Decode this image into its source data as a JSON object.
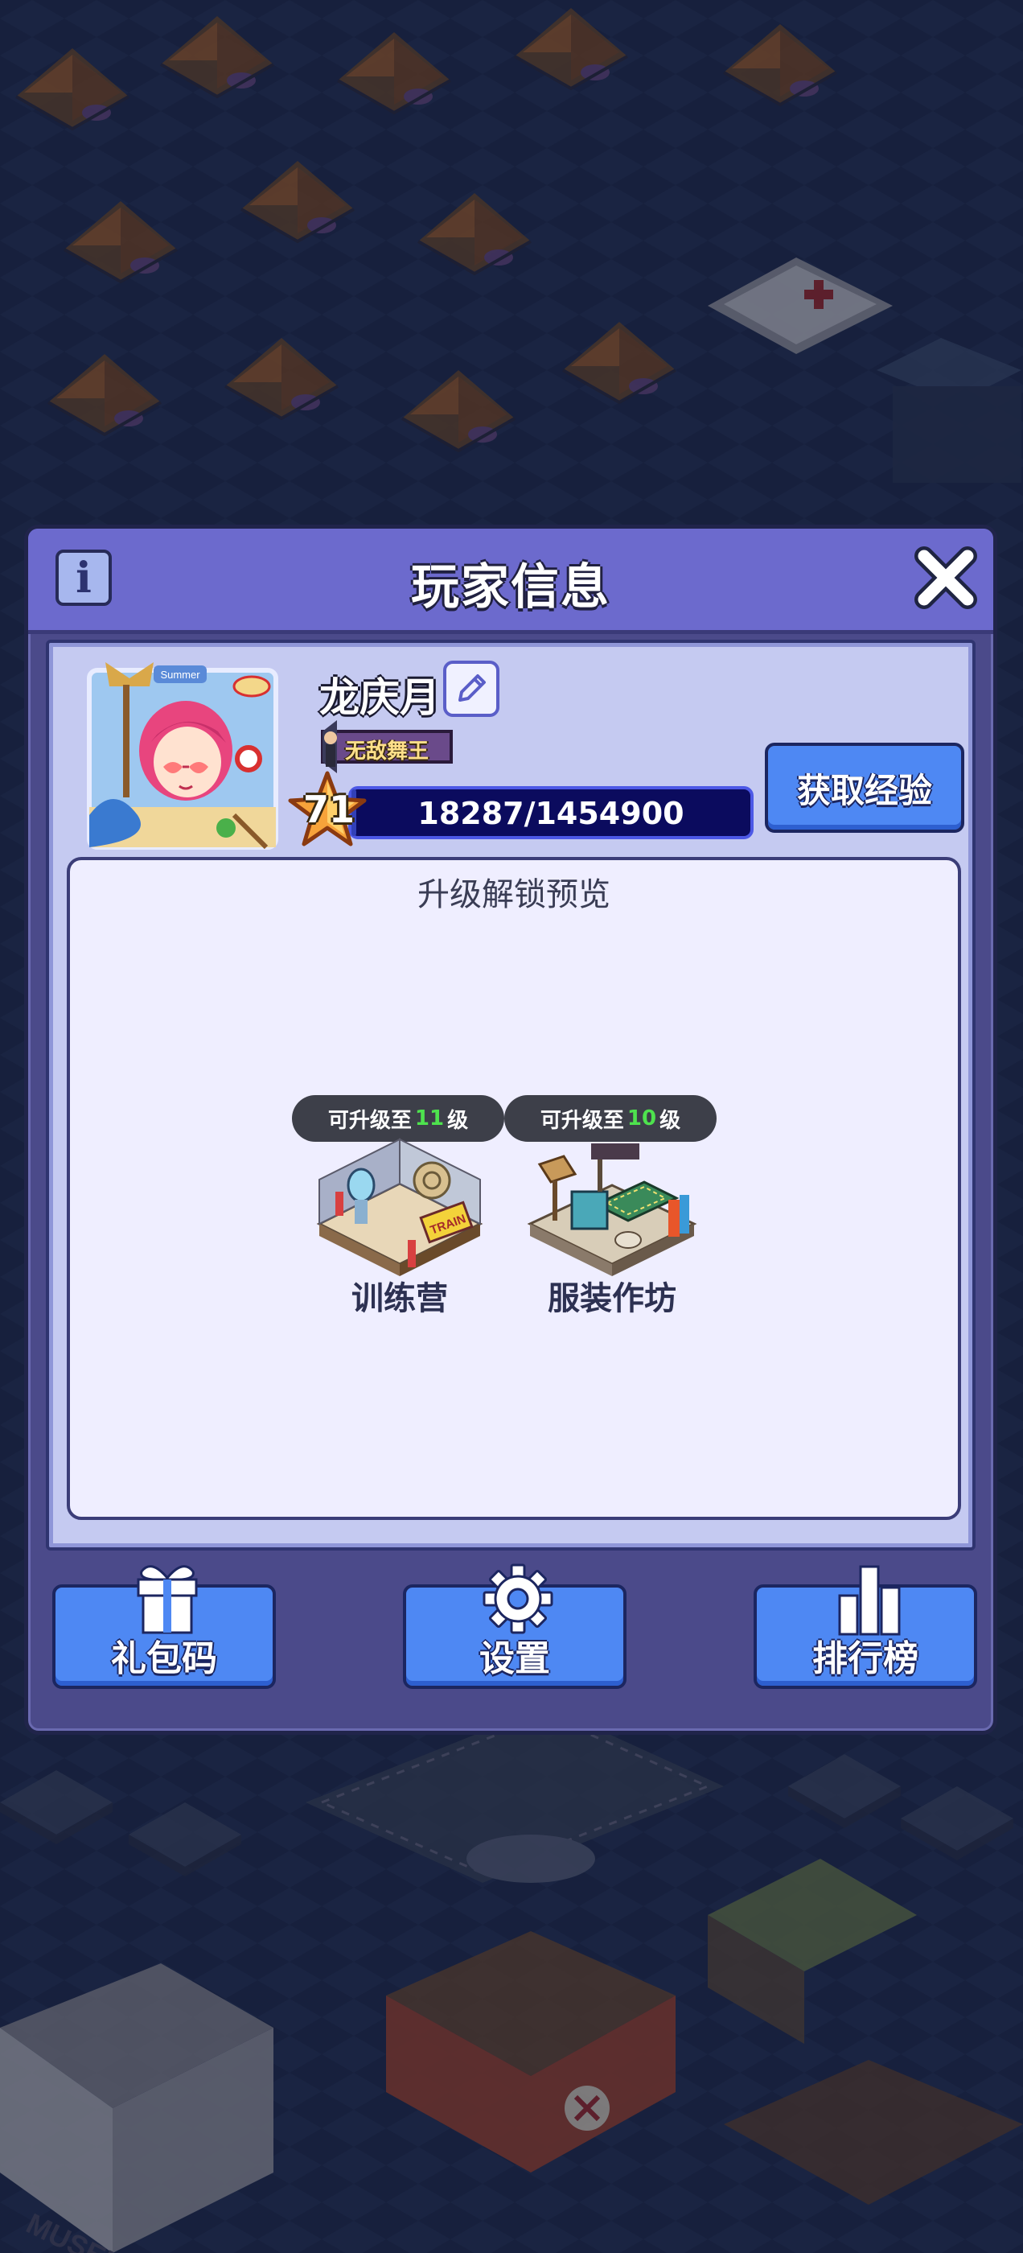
{
  "dialog": {
    "title": "玩家信息",
    "player": {
      "name": "龙庆月",
      "title_badge": "无敌舞王",
      "level": "71",
      "xp_text": "18287/1454900",
      "xp_progress": 0.0126,
      "avatar_sign": "Summer"
    },
    "get_xp_label": "获取经验",
    "preview": {
      "title": "升级解锁预览",
      "items": [
        {
          "prefix": "可升级至",
          "level": "11",
          "suffix": "级",
          "name": "训练营",
          "sign": "TRAIN"
        },
        {
          "prefix": "可升级至",
          "level": "10",
          "suffix": "级",
          "name": "服装作坊"
        }
      ]
    },
    "buttons": {
      "gift_code": "礼包码",
      "settings": "设置",
      "leaderboard": "排行榜"
    }
  },
  "scene": {
    "signs": [
      "MUSEUM"
    ]
  },
  "colors": {
    "title_bar": "#6c6acd",
    "button_blue": "#4e88f3",
    "panel": "#c5caf1",
    "level_green": "#4ee24e"
  },
  "icons": [
    "info-icon",
    "close-icon",
    "edit-icon",
    "star-icon",
    "gift-icon",
    "gear-icon",
    "leaderboard-icon"
  ]
}
